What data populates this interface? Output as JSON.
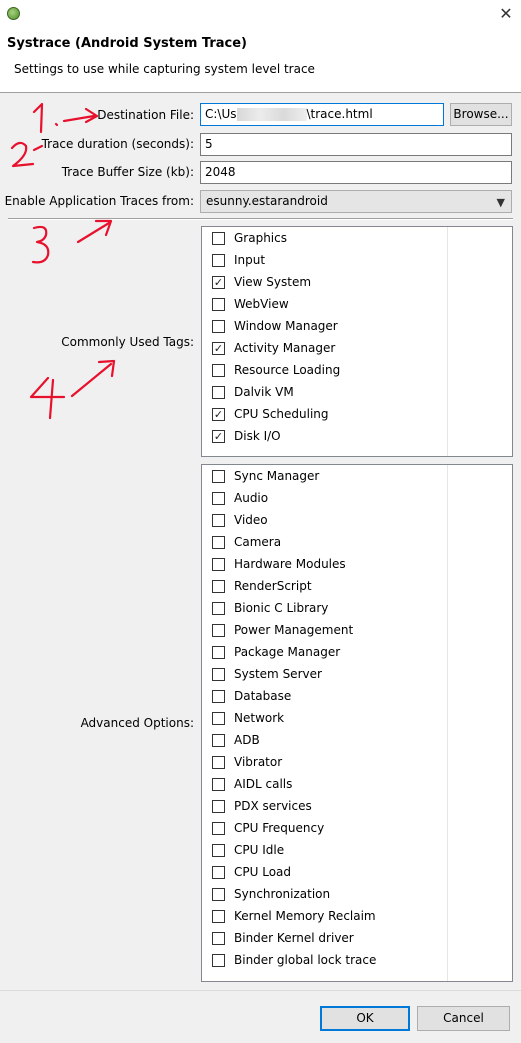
{
  "window": {
    "title": "Systrace (Android System Trace)",
    "subtitle": "Settings to use while capturing system level trace",
    "close_icon": "close-icon"
  },
  "form": {
    "destination_label": "Destination File:",
    "destination_prefix": "C:\\Us",
    "destination_suffix": "\\trace.html",
    "browse_label": "Browse...",
    "duration_label": "Trace duration (seconds):",
    "duration_value": "5",
    "buffer_label": "Trace Buffer Size (kb):",
    "buffer_value": "2048",
    "app_traces_label": "Enable Application Traces from:",
    "app_traces_value": "esunny.estarandroid"
  },
  "common_tags": {
    "label": "Commonly Used Tags:",
    "items": [
      {
        "label": "Graphics",
        "checked": false
      },
      {
        "label": "Input",
        "checked": false
      },
      {
        "label": "View System",
        "checked": true
      },
      {
        "label": "WebView",
        "checked": false
      },
      {
        "label": "Window Manager",
        "checked": false
      },
      {
        "label": "Activity Manager",
        "checked": true
      },
      {
        "label": "Resource Loading",
        "checked": false
      },
      {
        "label": "Dalvik VM",
        "checked": false
      },
      {
        "label": "CPU Scheduling",
        "checked": true
      },
      {
        "label": "Disk I/O",
        "checked": true
      }
    ]
  },
  "advanced": {
    "label": "Advanced Options:",
    "items": [
      {
        "label": "Sync Manager",
        "checked": false
      },
      {
        "label": "Audio",
        "checked": false
      },
      {
        "label": "Video",
        "checked": false
      },
      {
        "label": "Camera",
        "checked": false
      },
      {
        "label": "Hardware Modules",
        "checked": false
      },
      {
        "label": "RenderScript",
        "checked": false
      },
      {
        "label": "Bionic C Library",
        "checked": false
      },
      {
        "label": "Power Management",
        "checked": false
      },
      {
        "label": "Package Manager",
        "checked": false
      },
      {
        "label": "System Server",
        "checked": false
      },
      {
        "label": "Database",
        "checked": false
      },
      {
        "label": "Network",
        "checked": false
      },
      {
        "label": "ADB",
        "checked": false
      },
      {
        "label": "Vibrator",
        "checked": false
      },
      {
        "label": "AIDL calls",
        "checked": false
      },
      {
        "label": "PDX services",
        "checked": false
      },
      {
        "label": "CPU Frequency",
        "checked": false
      },
      {
        "label": "CPU Idle",
        "checked": false
      },
      {
        "label": "CPU Load",
        "checked": false
      },
      {
        "label": "Synchronization",
        "checked": false
      },
      {
        "label": "Kernel Memory Reclaim",
        "checked": false
      },
      {
        "label": "Binder Kernel driver",
        "checked": false
      },
      {
        "label": "Binder global lock trace",
        "checked": false
      }
    ]
  },
  "footer": {
    "ok_label": "OK",
    "cancel_label": "Cancel"
  },
  "annotations": {
    "color": "#e8112d",
    "marks": [
      "1.",
      "2",
      "3",
      "4"
    ]
  }
}
